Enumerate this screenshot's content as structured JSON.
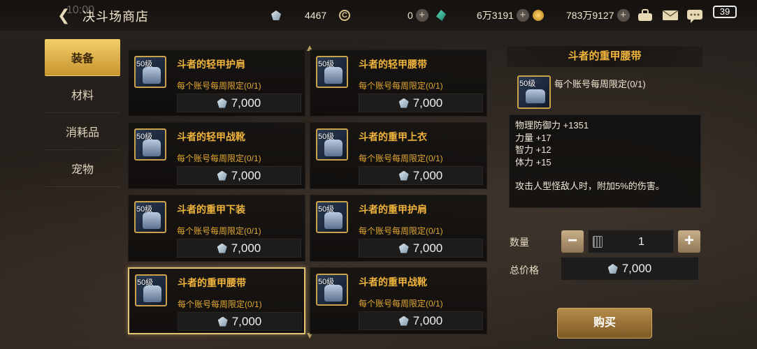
{
  "status": {
    "time": "10:00",
    "battery": "39"
  },
  "header": {
    "back_label": "<",
    "title": "决斗场商店"
  },
  "currencies": [
    {
      "value": "4467",
      "icon": "gem-icon"
    },
    {
      "value": "0",
      "icon": "coin-icon"
    },
    {
      "value": "6万3191",
      "icon": "crystal-icon"
    },
    {
      "value": "783万9127",
      "icon": "gold-icon"
    }
  ],
  "sidebar": {
    "items": [
      {
        "label": "装备"
      },
      {
        "label": "材料"
      },
      {
        "label": "消耗品"
      },
      {
        "label": "宠物"
      }
    ]
  },
  "items": [
    {
      "level": "50级",
      "name": "斗者的轻甲护肩",
      "limit": "每个账号每周限定(0/1)",
      "price": "7,000"
    },
    {
      "level": "50级",
      "name": "斗者的轻甲腰带",
      "limit": "每个账号每周限定(0/1)",
      "price": "7,000"
    },
    {
      "level": "50级",
      "name": "斗者的轻甲战靴",
      "limit": "每个账号每周限定(0/1)",
      "price": "7,000"
    },
    {
      "level": "50级",
      "name": "斗者的重甲上衣",
      "limit": "每个账号每周限定(0/1)",
      "price": "7,000"
    },
    {
      "level": "50级",
      "name": "斗者的重甲下装",
      "limit": "每个账号每周限定(0/1)",
      "price": "7,000"
    },
    {
      "level": "50级",
      "name": "斗者的重甲护肩",
      "limit": "每个账号每周限定(0/1)",
      "price": "7,000"
    },
    {
      "level": "50级",
      "name": "斗者的重甲腰带",
      "limit": "每个账号每周限定(0/1)",
      "price": "7,000"
    },
    {
      "level": "50级",
      "name": "斗者的重甲战靴",
      "limit": "每个账号每周限定(0/1)",
      "price": "7,000"
    }
  ],
  "detail": {
    "title": "斗者的重甲腰带",
    "level": "50级",
    "limit": "每个账号每周限定(0/1)",
    "stats": [
      "物理防御力 +1351",
      "力量 +17",
      "智力 +12",
      "体力 +15"
    ],
    "effect": "攻击人型怪敌人时，附加5%的伤害。",
    "quantity_label": "数量",
    "quantity": "1",
    "minus": "−",
    "plus": "+",
    "total_label": "总价格",
    "total": "7,000",
    "buy_label": "购买"
  }
}
